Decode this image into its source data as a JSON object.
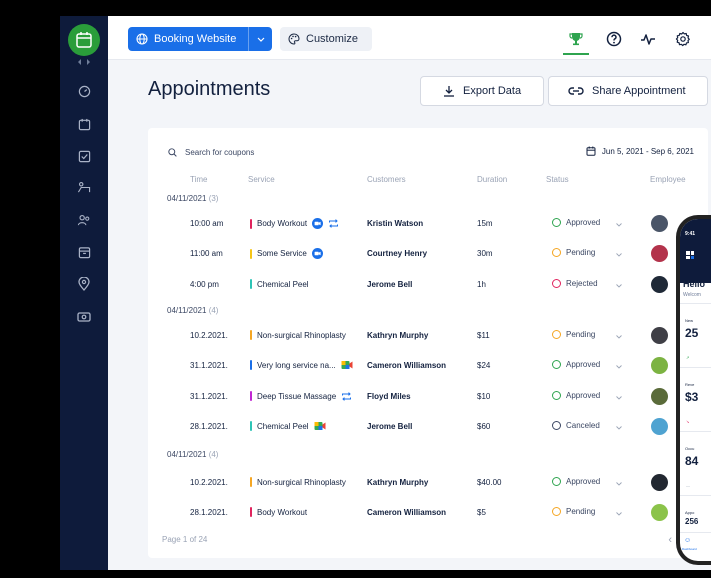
{
  "topbar": {
    "booking_label": "Booking Website",
    "customize_label": "Customize"
  },
  "header": {
    "title": "Appointments",
    "export_label": "Export Data",
    "share_label": "Share Appointment"
  },
  "toolbar": {
    "search_placeholder": "Search for coupons",
    "date_range": "Jun 5, 2021 - Sep 6, 2021"
  },
  "table": {
    "columns": [
      "Time",
      "Service",
      "Customers",
      "Duration",
      "Status",
      "Employee"
    ],
    "groups": [
      {
        "date": "04/11/2021",
        "count": "(3)"
      },
      {
        "date": "04/11/2021",
        "count": "(4)"
      },
      {
        "date": "04/11/2021",
        "count": "(4)"
      }
    ],
    "rows": [
      {
        "time": "10:00 am",
        "service": "Body Workout",
        "customer": "Kristin Watson",
        "duration": "15m",
        "status": "Approved"
      },
      {
        "time": "11:00 am",
        "service": "Some Service",
        "customer": "Courtney Henry",
        "duration": "30m",
        "status": "Pending"
      },
      {
        "time": "4:00 pm",
        "service": "Chemical Peel",
        "customer": "Jerome Bell",
        "duration": "1h",
        "status": "Rejected"
      },
      {
        "time": "10.2.2021.",
        "service": "Non-surgical Rhinoplasty",
        "customer": "Kathryn Murphy",
        "duration": "$11",
        "status": "Pending"
      },
      {
        "time": "31.1.2021.",
        "service": "Very long service na...",
        "customer": "Cameron Williamson",
        "duration": "$24",
        "status": "Approved"
      },
      {
        "time": "31.1.2021.",
        "service": "Deep Tissue Massage",
        "customer": "Floyd Miles",
        "duration": "$10",
        "status": "Approved"
      },
      {
        "time": "28.1.2021.",
        "service": "Chemical Peel",
        "customer": "Jerome Bell",
        "duration": "$60",
        "status": "Canceled"
      },
      {
        "time": "10.2.2021.",
        "service": "Non-surgical Rhinoplasty",
        "customer": "Kathryn Murphy",
        "duration": "$40.00",
        "status": "Approved"
      },
      {
        "time": "28.1.2021.",
        "service": "Body Workout",
        "customer": "Cameron Williamson",
        "duration": "$5",
        "status": "Pending"
      }
    ],
    "page_info": "Page 1 of 24"
  },
  "phone": {
    "time": "9:41",
    "greeting": "Hello",
    "welcome": "Welcom",
    "stat1_label": "New",
    "stat1_value": "25",
    "stat2_label": "Reve",
    "stat2_value": "$3",
    "stat3_label": "Occu",
    "stat3_value": "84",
    "stat4_label": "Appo",
    "stat4_value": "256",
    "nav_label": "Dashboard"
  },
  "colors": {
    "primary": "#1a6fe8",
    "sidebar": "#0e1b3b",
    "approved": "#2ea44f",
    "pending": "#f5a623",
    "rejected": "#e0245e",
    "canceled": "#3b4763"
  }
}
